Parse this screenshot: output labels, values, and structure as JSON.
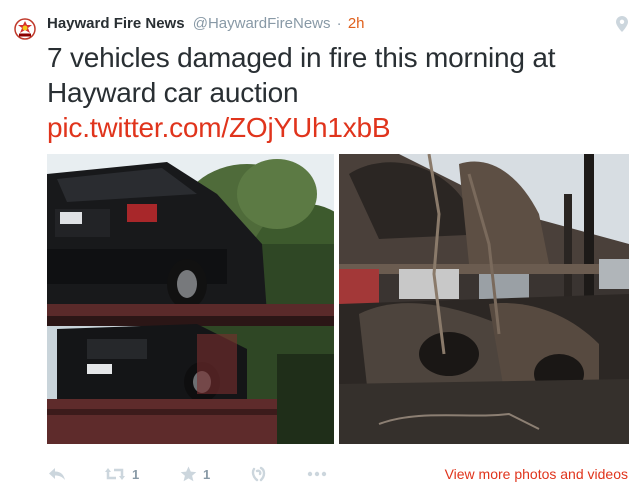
{
  "tweet": {
    "author_name": "Hayward Fire News",
    "handle": "@HaywardFireNews",
    "separator": "·",
    "time": "2h",
    "text": "7 vehicles damaged in fire this morning at Hayward car auction",
    "link": "pic.twitter.com/ZOjYUh1xbB"
  },
  "media": {
    "photos": [
      {
        "description_icon": "photo-car-carrier"
      },
      {
        "description_icon": "photo-burned-cars"
      }
    ]
  },
  "actions": {
    "reply_icon": "reply-icon",
    "retweet_icon": "retweet-icon",
    "retweet_count": "1",
    "favorite_icon": "star-icon",
    "favorite_count": "1",
    "vine_icon": "vine-icon",
    "more_icon": "ellipsis-icon",
    "view_more": "View more photos and videos"
  },
  "colors": {
    "link": "#e0341c",
    "time": "#e0601c",
    "muted": "#8899a6",
    "text": "#292f33"
  }
}
